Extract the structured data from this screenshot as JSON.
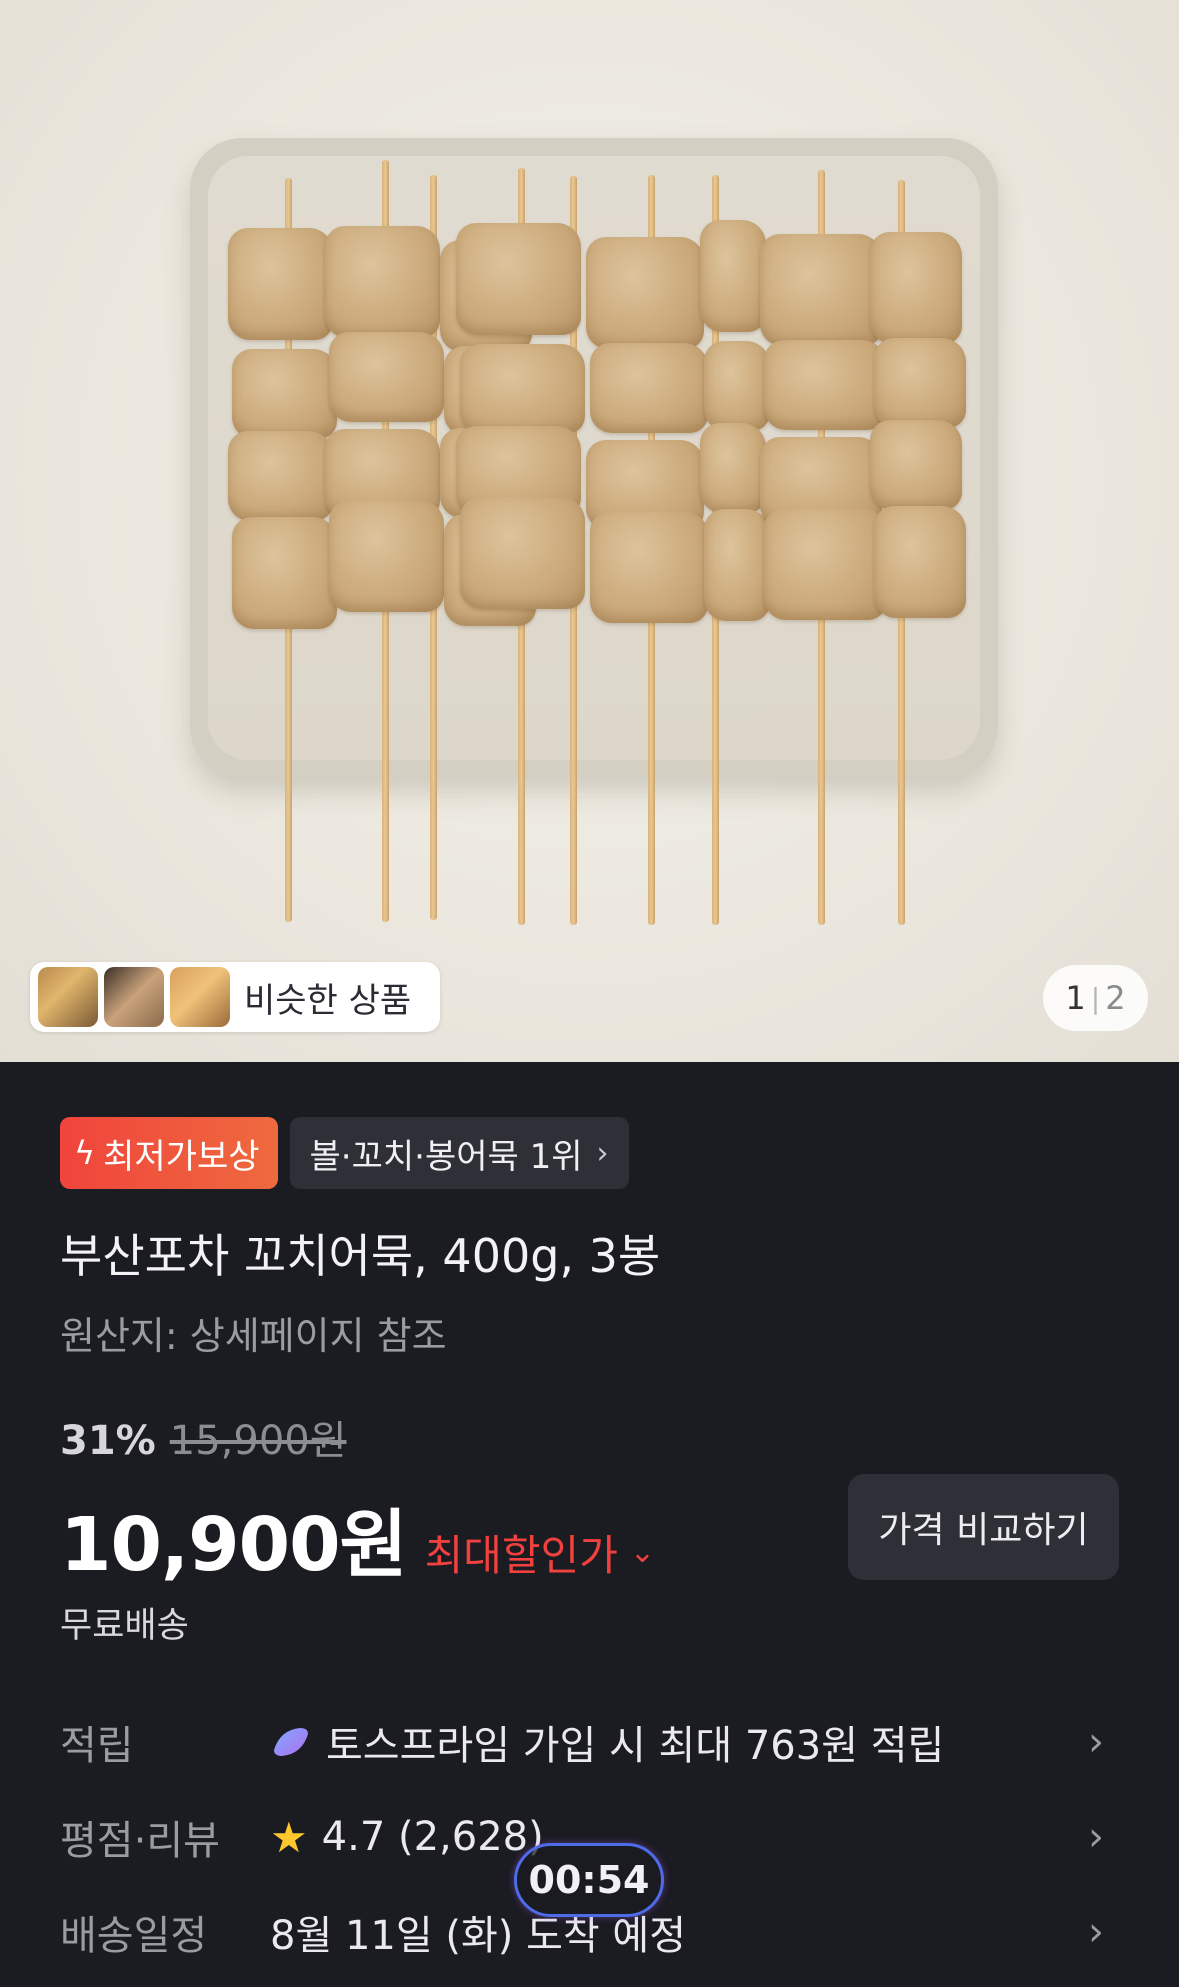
{
  "hero": {
    "similar_label": "비슷한 상품",
    "pager_current": "1",
    "pager_separator": "|",
    "pager_total": "2"
  },
  "badges": {
    "lowest_price": "최저가보상",
    "rank": "볼·꼬치·봉어묵 1위"
  },
  "product": {
    "title": "부산포차 꼬치어묵, 400g, 3봉",
    "origin": "원산지: 상세페이지 참조"
  },
  "price": {
    "discount": "31%",
    "original": "15,900원",
    "current": "10,900원",
    "max_discount_label": "최대할인가",
    "compare_button": "가격 비교하기",
    "shipping": "무료배송"
  },
  "rows": {
    "points_label": "적립",
    "points_value": "토스프라임 가입 시 최대 763원 적립",
    "rating_label": "평점·리뷰",
    "rating_value": "4.7 (2,628)",
    "delivery_label": "배송일정",
    "delivery_value": "8월 11일 (화) 도착 예정"
  },
  "timer": "00:54",
  "colors": {
    "background": "#1b1b22",
    "accent_red": "#f0413f",
    "star": "#ffc72c",
    "timer_border": "#4e6be8"
  },
  "icons": [
    "bolt-icon",
    "chevron-right-icon",
    "chevron-down-icon",
    "toss-prime-icon",
    "star-icon"
  ]
}
